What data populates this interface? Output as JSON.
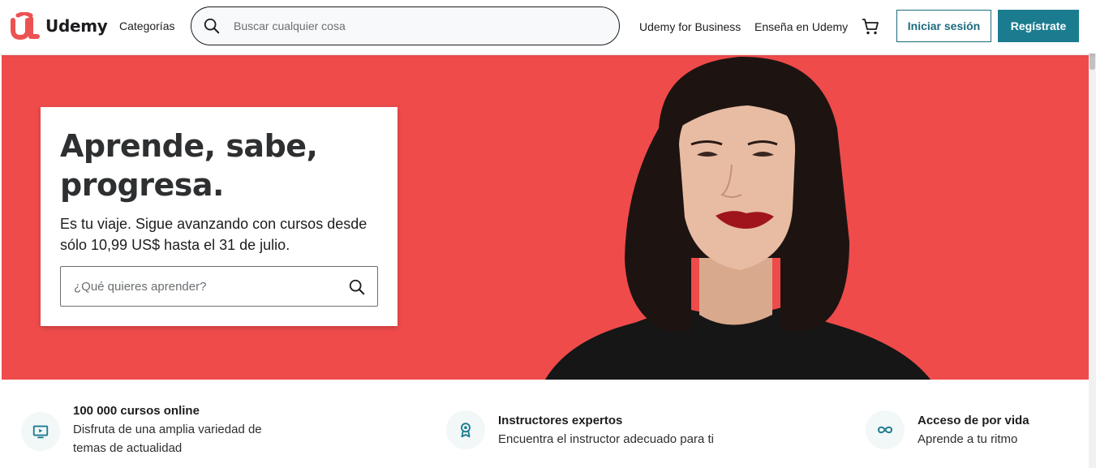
{
  "header": {
    "logo_text": "Udemy",
    "categories_label": "Categorías",
    "search_placeholder": "Buscar cualquier cosa",
    "business_link": "Udemy for Business",
    "teach_link": "Enseña en Udemy",
    "login_label": "Iniciar sesión",
    "signup_label": "Regístrate"
  },
  "hero": {
    "title": "Aprende, sabe, progresa.",
    "subtitle": "Es tu viaje. Sigue avanzando con cursos desde sólo 10,99 US$ hasta el 31 de julio.",
    "search_placeholder": "¿Qué quieres aprender?",
    "background_color": "#ef4b4b"
  },
  "features": [
    {
      "icon": "tv-icon",
      "title": "100 000 cursos online",
      "desc": "Disfruta de una amplia variedad de temas de actualidad"
    },
    {
      "icon": "award-icon",
      "title": "Instructores expertos",
      "desc": "Encuentra el instructor adecuado para ti"
    },
    {
      "icon": "infinity-icon",
      "title": "Acceso de por vida",
      "desc": "Aprende a tu ritmo"
    }
  ],
  "colors": {
    "brand": "#ec5252",
    "accent": "#1c7c8f"
  }
}
